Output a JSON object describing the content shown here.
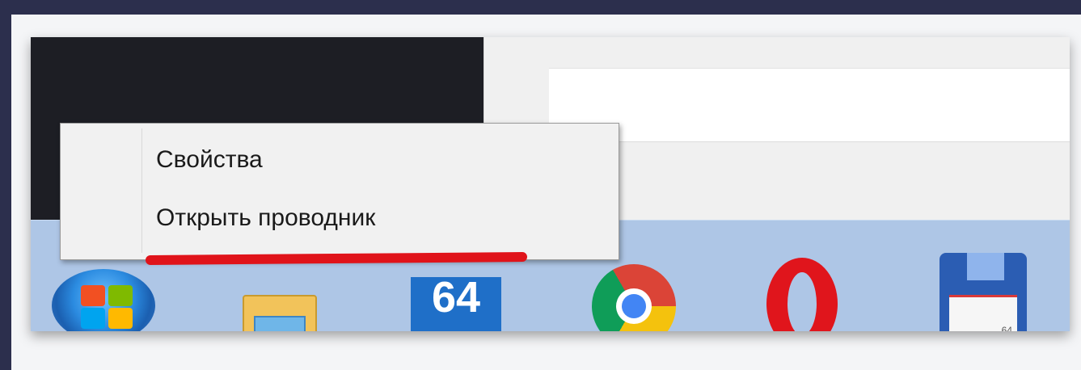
{
  "context_menu": {
    "items": [
      {
        "label": "Свойства"
      },
      {
        "label": "Открыть проводник"
      }
    ],
    "highlight_color": "#e0131a"
  },
  "taskbar": {
    "icons": [
      {
        "name": "start-orb-icon"
      },
      {
        "name": "file-explorer-icon"
      },
      {
        "name": "aida64-icon",
        "text": "64"
      },
      {
        "name": "chrome-icon"
      },
      {
        "name": "opera-icon"
      },
      {
        "name": "floppy-save-icon",
        "text": "64"
      }
    ],
    "color": "#aec6e6"
  },
  "colors": {
    "background": "#2c2f4d",
    "dark_window": "#1d1e24",
    "light_window": "#f0f0f0"
  }
}
